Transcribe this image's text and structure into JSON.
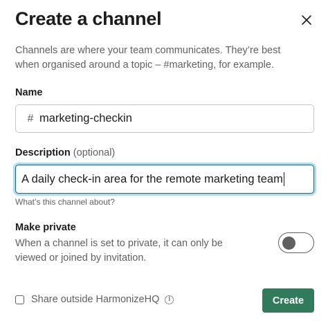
{
  "dialog": {
    "title": "Create a channel",
    "close_icon": "close-icon",
    "intro": "Channels are where your team communicates. They’re best when organised around a topic – #marketing, for example."
  },
  "name_field": {
    "label": "Name",
    "prefix": "#",
    "value": "marketing-checkin"
  },
  "description_field": {
    "label": "Description",
    "optional_label": "(optional)",
    "value": "A daily check-in area for the remote marketing team",
    "hint": "What’s this channel about?"
  },
  "make_private": {
    "label": "Make private",
    "description": "When a channel is set to private, it can only be viewed or joined by invitation.",
    "enabled": false
  },
  "footer": {
    "share_label": "Share outside HarmonizeHQ",
    "share_checked": false,
    "info_icon": "info-icon",
    "create_label": "Create"
  },
  "colors": {
    "primary_button": "#2f7b5c",
    "focus_border": "#1264a3",
    "muted_text": "#616061"
  }
}
